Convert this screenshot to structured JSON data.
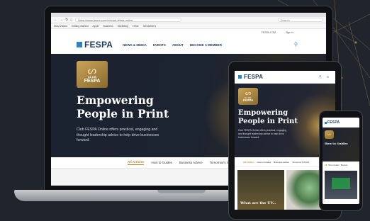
{
  "browser": {
    "nav": [
      "←",
      "→",
      "↻",
      "⌂"
    ],
    "url": "https://www.fespa.com/en/club-fespa-online",
    "search_placeholder": "Search",
    "bookmarks": [
      "Most Visited",
      "Getting Started",
      "Apple",
      "Business",
      "Marketing",
      "Other",
      "Newsletters"
    ],
    "utility": [
      "FESPA.COM",
      "Sign In"
    ]
  },
  "site": {
    "logo": "FESPA",
    "menu": [
      "NEWS & MEDIA",
      "EVENTS",
      "ABOUT",
      "BECOME A MEMBER"
    ],
    "search_icon": "⚲"
  },
  "hero": {
    "badge_symbol": "ᔕ",
    "badge_line1": "CLUB",
    "badge_line2": "FESPA",
    "title_line1": "Empowering",
    "title_line2": "People in Print",
    "text": "Club FESPA Online offers practical, engaging and thought leadership advice to help drive businesses forward."
  },
  "tabs": [
    "All Articles",
    "How to Guides",
    "Business Advice",
    "Tomorrow's World",
    "FESPA Events"
  ],
  "tablet": {
    "icons": "⚲ ≡",
    "tabs": [
      "All Articles",
      "How to Guides",
      "Business Advice",
      "Tomorrow's World"
    ],
    "card_title": "What are the UV..."
  },
  "phone": {
    "tabs": [
      "All",
      "How to Guides",
      "Business"
    ],
    "hero_title": "How to Guides"
  },
  "colors": {
    "brand_blue": "#2d83c5",
    "brand_navy": "#1e3a5f",
    "gold_accent": "#b98a2e",
    "hero_dark": "#1b2230"
  }
}
